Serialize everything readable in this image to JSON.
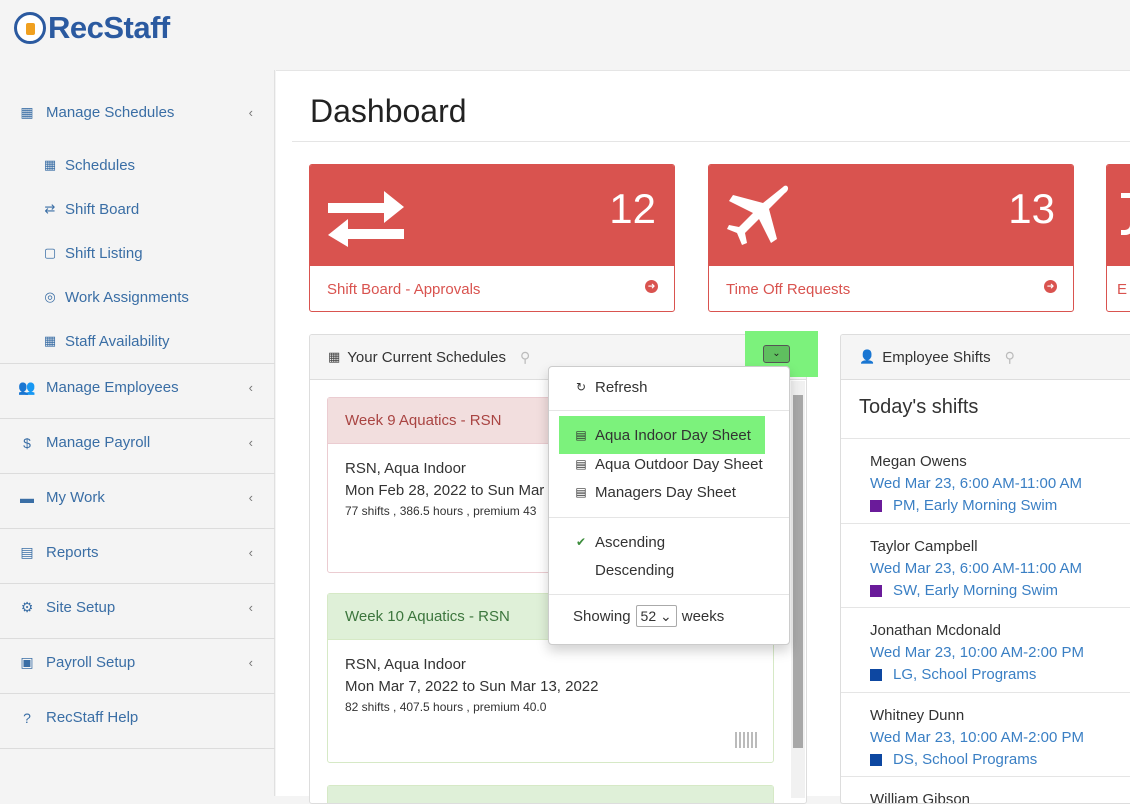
{
  "app": {
    "logo_text": "RecStaff"
  },
  "sidebar": {
    "items": [
      {
        "label": "Manage Schedules",
        "icon": "calendar-icon",
        "expanded": true
      },
      {
        "label": "Manage Employees",
        "icon": "users-icon"
      },
      {
        "label": "Manage Payroll",
        "icon": "dollar-icon"
      },
      {
        "label": "My Work",
        "icon": "briefcase-icon"
      },
      {
        "label": "Reports",
        "icon": "file-icon"
      },
      {
        "label": "Site Setup",
        "icon": "cogs-icon"
      },
      {
        "label": "Payroll Setup",
        "icon": "money-icon"
      },
      {
        "label": "RecStaff Help",
        "icon": "question-icon"
      }
    ],
    "subitems": [
      {
        "label": "Schedules",
        "icon": "calendar-icon"
      },
      {
        "label": "Shift Board",
        "icon": "exchange-icon"
      },
      {
        "label": "Shift Listing",
        "icon": "calendar-o-icon"
      },
      {
        "label": "Work Assignments",
        "icon": "life-ring-icon"
      },
      {
        "label": "Staff Availability",
        "icon": "grid-icon"
      }
    ]
  },
  "main": {
    "title": "Dashboard",
    "cards": [
      {
        "value": "12",
        "label": "Shift Board - Approvals",
        "icon": "exchange-icon"
      },
      {
        "value": "13",
        "label": "Time Off Requests",
        "icon": "plane-icon"
      },
      {
        "label": "E"
      }
    ],
    "colors": {
      "danger": "#d9534f",
      "link": "#3a7fc4",
      "highlight": "#7cf27c"
    }
  },
  "schedules": {
    "title": "Your Current Schedules",
    "cards": [
      {
        "title": "Week 9 Aquatics - RSN",
        "location": "RSN, Aqua Indoor",
        "dates": "Mon Feb 28, 2022 to Sun Mar",
        "stats": "77 shifts , 386.5 hours , premium 43",
        "status": "red"
      },
      {
        "title": "Week 10 Aquatics - RSN",
        "location": "RSN, Aqua Indoor",
        "dates": "Mon Mar 7, 2022 to Sun Mar 13, 2022",
        "stats": "82 shifts , 407.5 hours , premium 40.0",
        "status": "green"
      }
    ]
  },
  "dropdown": {
    "refresh": "Refresh",
    "sheets": [
      "Aqua Indoor Day Sheet",
      "Aqua Outdoor Day Sheet",
      "Managers Day Sheet"
    ],
    "sort": [
      "Ascending",
      "Descending"
    ],
    "sort_selected": "Ascending",
    "showing_label": "Showing",
    "weeks_value": "52",
    "weeks_label": "weeks"
  },
  "employee_shifts": {
    "title": "Employee Shifts",
    "subtitle": "Today's shifts",
    "shifts": [
      {
        "name": "Megan Owens",
        "time": "Wed Mar 23, 6:00 AM-11:00 AM",
        "position": "PM, Early Morning Swim",
        "color": "#6a1b9a"
      },
      {
        "name": "Taylor Campbell",
        "time": "Wed Mar 23, 6:00 AM-11:00 AM",
        "position": "SW, Early Morning Swim",
        "color": "#6a1b9a"
      },
      {
        "name": "Jonathan Mcdonald",
        "time": "Wed Mar 23, 10:00 AM-2:00 PM",
        "position": "LG, School Programs",
        "color": "#0d47a1"
      },
      {
        "name": "Whitney Dunn",
        "time": "Wed Mar 23, 10:00 AM-2:00 PM",
        "position": "DS, School Programs",
        "color": "#0d47a1"
      },
      {
        "name": "William Gibson"
      }
    ]
  }
}
